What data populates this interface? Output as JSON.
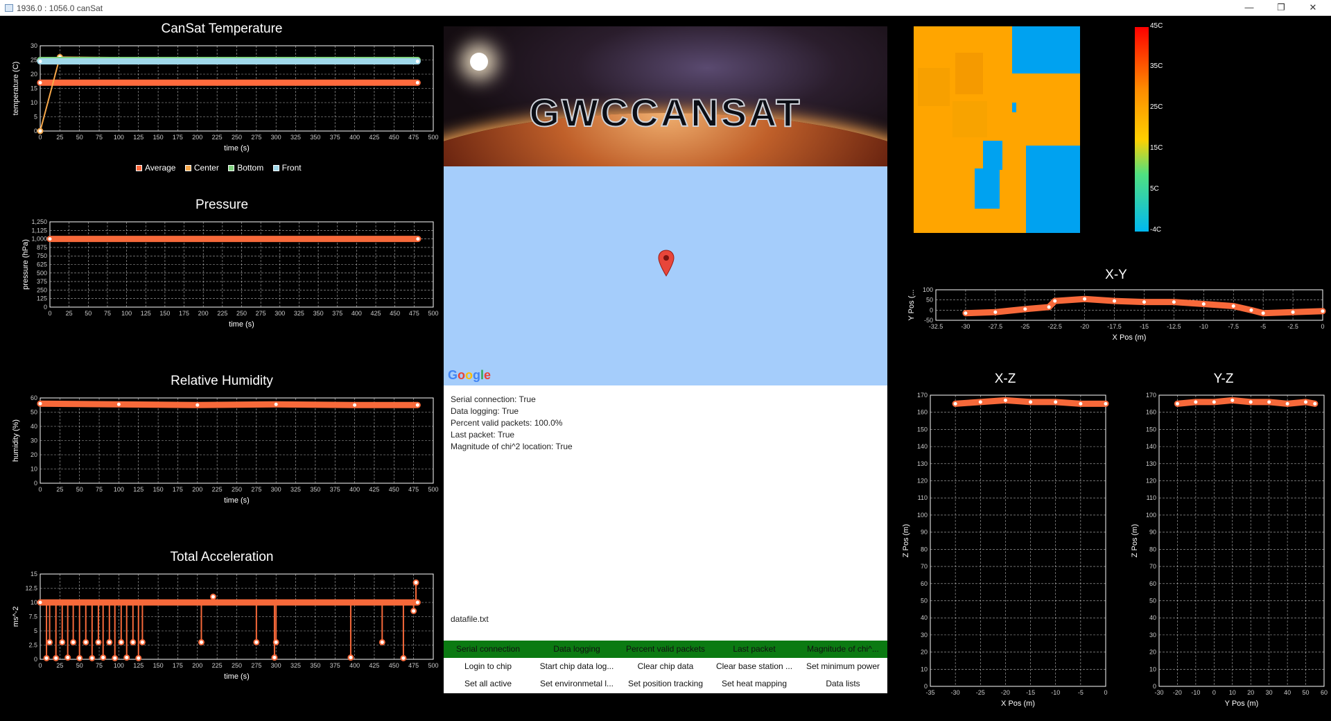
{
  "window": {
    "title": "1936.0 : 1056.0 canSat",
    "minimize": "—",
    "restore": "❐",
    "close": "✕"
  },
  "temperature": {
    "title": "CanSat Temperature",
    "xlabel": "time (s)",
    "ylabel": "temperature (C)",
    "legend": [
      {
        "name": "Average",
        "color": "#ff6a3d"
      },
      {
        "name": "Center",
        "color": "#f7a84a"
      },
      {
        "name": "Bottom",
        "color": "#7ed07e"
      },
      {
        "name": "Front",
        "color": "#9fd8ea"
      }
    ]
  },
  "pressure": {
    "title": "Pressure",
    "xlabel": "time (s)",
    "ylabel": "pressure (hPa)"
  },
  "humidity": {
    "title": "Relative Humidity",
    "xlabel": "time (s)",
    "ylabel": "humidity (%)"
  },
  "acceleration": {
    "title": "Total Acceleration",
    "xlabel": "time (s)",
    "ylabel": "ms^-2"
  },
  "xy": {
    "title": "X-Y",
    "xlabel": "X Pos (m)",
    "ylabel": "Y Pos (..."
  },
  "xz": {
    "title": "X-Z",
    "xlabel": "X Pos (m)",
    "ylabel": "Z Pos (m)"
  },
  "yz": {
    "title": "Y-Z",
    "xlabel": "Y Pos (m)",
    "ylabel": "Z Pos (m)"
  },
  "banner": {
    "logo": "GWCCANSAT"
  },
  "map": {
    "provider": "Google"
  },
  "status": {
    "lines": [
      "Serial connection: True",
      "Data logging: True",
      "Percent valid packets: 100.0%",
      "Last packet: True",
      "Magnitude of chi^2 location: True"
    ],
    "file": "datafile.txt"
  },
  "indicators": [
    "Serial connection",
    "Data logging",
    "Percent valid packets",
    "Last packet",
    "Magnitude of chi^..."
  ],
  "buttons_row1": [
    "Login to chip",
    "Start chip data log...",
    "Clear chip data",
    "Clear base station ...",
    "Set minimum power"
  ],
  "buttons_row2": [
    "Set all active",
    "Set environmetal l...",
    "Set position tracking",
    "Set heat mapping",
    "Data lists"
  ],
  "heatmap": {
    "scale": [
      "45C",
      "35C",
      "25C",
      "15C",
      "5C",
      "-4C"
    ],
    "colors": {
      "warm": "#ffa500",
      "cool": "#00a2f0"
    }
  },
  "chart_data": [
    {
      "type": "scatter",
      "title": "CanSat Temperature",
      "xlabel": "time (s)",
      "ylabel": "temperature (C)",
      "xlim": [
        0,
        500
      ],
      "ylim": [
        0,
        30
      ],
      "xticks": [
        0,
        25,
        50,
        75,
        100,
        125,
        150,
        175,
        200,
        225,
        250,
        275,
        300,
        325,
        350,
        375,
        400,
        425,
        450,
        475,
        500
      ],
      "yticks": [
        0,
        5,
        10,
        15,
        20,
        25,
        30
      ],
      "series": [
        {
          "name": "Average",
          "color": "#ff6a3d",
          "x": [
            0,
            480
          ],
          "y": [
            17,
            17
          ]
        },
        {
          "name": "Center",
          "color": "#f7a84a",
          "x": [
            0,
            25,
            480
          ],
          "y": [
            0,
            26,
            25
          ]
        },
        {
          "name": "Bottom",
          "color": "#7ed07e",
          "x": [
            0,
            480
          ],
          "y": [
            25,
            25
          ]
        },
        {
          "name": "Front",
          "color": "#9fd8ea",
          "x": [
            0,
            480
          ],
          "y": [
            24.5,
            24.5
          ]
        }
      ]
    },
    {
      "type": "line",
      "title": "Pressure",
      "xlabel": "time (s)",
      "ylabel": "pressure (hPa)",
      "xlim": [
        0,
        500
      ],
      "ylim": [
        0,
        1250
      ],
      "xticks": [
        0,
        25,
        50,
        75,
        100,
        125,
        150,
        175,
        200,
        225,
        250,
        275,
        300,
        325,
        350,
        375,
        400,
        425,
        450,
        475,
        500
      ],
      "yticks": [
        0,
        125,
        250,
        375,
        500,
        625,
        750,
        875,
        1000,
        1125,
        1250
      ],
      "series": [
        {
          "x": [
            0,
            480
          ],
          "y": [
            1000,
            1000
          ]
        }
      ]
    },
    {
      "type": "line",
      "title": "Relative Humidity",
      "xlabel": "time (s)",
      "ylabel": "humidity (%)",
      "xlim": [
        0,
        500
      ],
      "ylim": [
        0,
        60
      ],
      "xticks": [
        0,
        25,
        50,
        75,
        100,
        125,
        150,
        175,
        200,
        225,
        250,
        275,
        300,
        325,
        350,
        375,
        400,
        425,
        450,
        475,
        500
      ],
      "yticks": [
        0,
        10,
        20,
        30,
        40,
        50,
        60
      ],
      "series": [
        {
          "x": [
            0,
            100,
            200,
            300,
            400,
            480
          ],
          "y": [
            56,
            55.5,
            55,
            55.5,
            55,
            55
          ]
        }
      ]
    },
    {
      "type": "line",
      "title": "Total Acceleration",
      "xlabel": "time (s)",
      "ylabel": "ms^-2",
      "xlim": [
        0,
        500
      ],
      "ylim": [
        0,
        15
      ],
      "xticks": [
        0,
        25,
        50,
        75,
        100,
        125,
        150,
        175,
        200,
        225,
        250,
        275,
        300,
        325,
        350,
        375,
        400,
        425,
        450,
        475,
        500
      ],
      "yticks": [
        0,
        2.5,
        5,
        7.5,
        10,
        12.5,
        15
      ],
      "series": [
        {
          "x": [
            0,
            480
          ],
          "y": [
            10,
            10
          ]
        }
      ],
      "drops": [
        {
          "x": 8,
          "y": 0.2
        },
        {
          "x": 12,
          "y": 3
        },
        {
          "x": 20,
          "y": 0.2
        },
        {
          "x": 28,
          "y": 3
        },
        {
          "x": 35,
          "y": 0.3
        },
        {
          "x": 42,
          "y": 3
        },
        {
          "x": 50,
          "y": 0.2
        },
        {
          "x": 58,
          "y": 3
        },
        {
          "x": 66,
          "y": 0.2
        },
        {
          "x": 74,
          "y": 3
        },
        {
          "x": 80,
          "y": 0.3
        },
        {
          "x": 88,
          "y": 3
        },
        {
          "x": 95,
          "y": 0.2
        },
        {
          "x": 103,
          "y": 3
        },
        {
          "x": 110,
          "y": 0.3
        },
        {
          "x": 118,
          "y": 3
        },
        {
          "x": 125,
          "y": 0.2
        },
        {
          "x": 130,
          "y": 3
        },
        {
          "x": 205,
          "y": 3
        },
        {
          "x": 275,
          "y": 3
        },
        {
          "x": 298,
          "y": 0.3
        },
        {
          "x": 300,
          "y": 3
        },
        {
          "x": 395,
          "y": 0.3
        },
        {
          "x": 435,
          "y": 3
        },
        {
          "x": 462,
          "y": 0.2
        }
      ],
      "spikes": [
        {
          "x": 220,
          "y": 11
        },
        {
          "x": 478,
          "y": 13.5
        },
        {
          "x": 475,
          "y": 8.5
        }
      ]
    },
    {
      "type": "scatter",
      "title": "X-Y",
      "xlabel": "X Pos (m)",
      "ylabel": "Y Pos (...",
      "xlim": [
        -32.5,
        0
      ],
      "ylim": [
        -50,
        100
      ],
      "xticks": [
        -32.5,
        -30,
        -27.5,
        -25,
        -22.5,
        -20,
        -17.5,
        -15,
        -12.5,
        -10,
        -7.5,
        -5,
        -2.5,
        0
      ],
      "yticks": [
        -50,
        0,
        50,
        100
      ],
      "series": [
        {
          "x": [
            -30,
            -27.5,
            -25,
            -23,
            -22.5,
            -20,
            -17.5,
            -15,
            -12.5,
            -10,
            -7.5,
            -6,
            -5,
            -2.5,
            0
          ],
          "y": [
            -15,
            -10,
            5,
            15,
            45,
            55,
            45,
            40,
            40,
            30,
            20,
            0,
            -15,
            -10,
            -5
          ]
        }
      ]
    },
    {
      "type": "scatter",
      "title": "X-Z",
      "xlabel": "X Pos (m)",
      "ylabel": "Z Pos (m)",
      "xlim": [
        -35,
        0
      ],
      "ylim": [
        0,
        170
      ],
      "xticks": [
        -35,
        -30,
        -25,
        -20,
        -15,
        -10,
        -5,
        0
      ],
      "yticks": [
        0,
        10,
        20,
        30,
        40,
        50,
        60,
        70,
        80,
        90,
        100,
        110,
        120,
        130,
        140,
        150,
        160,
        170
      ],
      "series": [
        {
          "x": [
            -30,
            -25,
            -20,
            -15,
            -10,
            -5,
            0
          ],
          "y": [
            165,
            166,
            167,
            166,
            166,
            165,
            165
          ]
        }
      ]
    },
    {
      "type": "scatter",
      "title": "Y-Z",
      "xlabel": "Y Pos (m)",
      "ylabel": "Z Pos (m)",
      "xlim": [
        -30,
        60
      ],
      "ylim": [
        0,
        170
      ],
      "xticks": [
        -30,
        -20,
        -10,
        0,
        10,
        20,
        30,
        40,
        50,
        60
      ],
      "yticks": [
        0,
        10,
        20,
        30,
        40,
        50,
        60,
        70,
        80,
        90,
        100,
        110,
        120,
        130,
        140,
        150,
        160,
        170
      ],
      "series": [
        {
          "x": [
            -20,
            -10,
            0,
            10,
            20,
            30,
            40,
            50,
            55
          ],
          "y": [
            165,
            166,
            166,
            167,
            166,
            166,
            165,
            166,
            165
          ]
        }
      ]
    }
  ]
}
